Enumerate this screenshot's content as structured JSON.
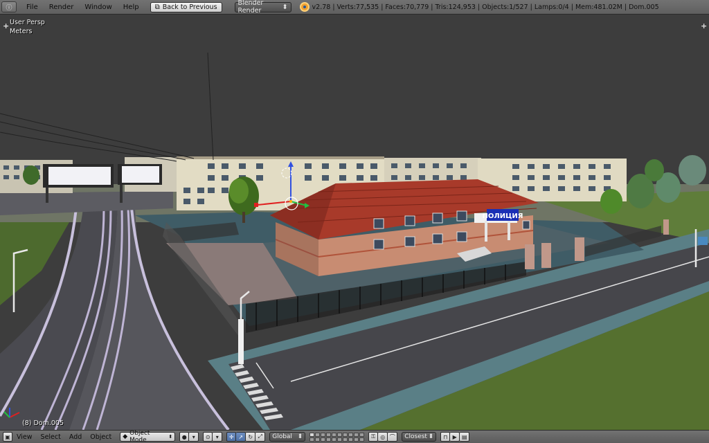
{
  "top_bar": {
    "menus": [
      "File",
      "Render",
      "Window",
      "Help"
    ],
    "back_button": "Back to Previous",
    "render_engine": "Blender Render",
    "stats": "v2.78 | Verts:77,535 | Faces:70,779 | Tris:124,953 | Objects:1/527 | Lamps:0/4 | Mem:481.02M | Dom.005"
  },
  "viewport": {
    "view_name": "User Persp",
    "units": "Meters",
    "active_object": "(8) Dom.005",
    "sign_text": "ПОЛИЦИЯ"
  },
  "bottom_bar": {
    "menus": [
      "View",
      "Select",
      "Add",
      "Object"
    ],
    "mode": "Object Mode",
    "orientation": "Global",
    "snap_target": "Closest"
  },
  "colors": {
    "header": "#6a6a6a",
    "viewport_bg": "#3d3d3d",
    "roof": "#a83a2a",
    "wall": "#c08a70",
    "sign": "#1a2fb5",
    "grass": "#4a6a2a",
    "road": "#4a4a4f"
  }
}
